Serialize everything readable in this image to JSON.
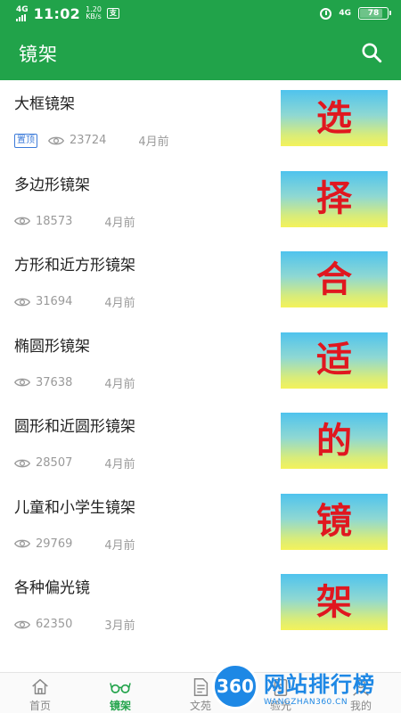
{
  "status": {
    "signal": "4G",
    "time": "11:02",
    "speed_value": "1.20",
    "speed_unit": "KB/s",
    "mini_badge": "支",
    "net_right": "4G",
    "battery": "78",
    "battery_level": 0.78
  },
  "app_bar": {
    "title": "镜架",
    "search_icon": "search-icon"
  },
  "list": {
    "items": [
      {
        "title": "大框镜架",
        "pinned": true,
        "badge": "置顶",
        "views": "23724",
        "time": "4月前",
        "thumb": "选"
      },
      {
        "title": "多边形镜架",
        "pinned": false,
        "views": "18573",
        "time": "4月前",
        "thumb": "择"
      },
      {
        "title": "方形和近方形镜架",
        "pinned": false,
        "views": "31694",
        "time": "4月前",
        "thumb": "合"
      },
      {
        "title": "椭圆形镜架",
        "pinned": false,
        "views": "37638",
        "time": "4月前",
        "thumb": "适"
      },
      {
        "title": "圆形和近圆形镜架",
        "pinned": false,
        "views": "28507",
        "time": "4月前",
        "thumb": "的"
      },
      {
        "title": "儿童和小学生镜架",
        "pinned": false,
        "views": "29769",
        "time": "4月前",
        "thumb": "镜"
      },
      {
        "title": "各种偏光镜",
        "pinned": false,
        "views": "62350",
        "time": "3月前",
        "thumb": "架"
      }
    ]
  },
  "bottom_nav": {
    "items": [
      {
        "label": "首页",
        "icon": "home-icon",
        "active": false
      },
      {
        "label": "镜架",
        "icon": "glasses-icon",
        "active": true
      },
      {
        "label": "文苑",
        "icon": "document-icon",
        "active": false
      },
      {
        "label": "验光",
        "icon": "clipboard-icon",
        "active": false
      },
      {
        "label": "我的",
        "icon": "user-icon",
        "active": false
      }
    ]
  },
  "watermark": {
    "logo": "360",
    "main": "网站排行榜",
    "sub": "WANGZHAN360.CN"
  },
  "colors": {
    "primary": "#21a34a",
    "badge": "#3b7ad9",
    "thumb_text": "#e0171f",
    "watermark": "#1e88e5"
  }
}
